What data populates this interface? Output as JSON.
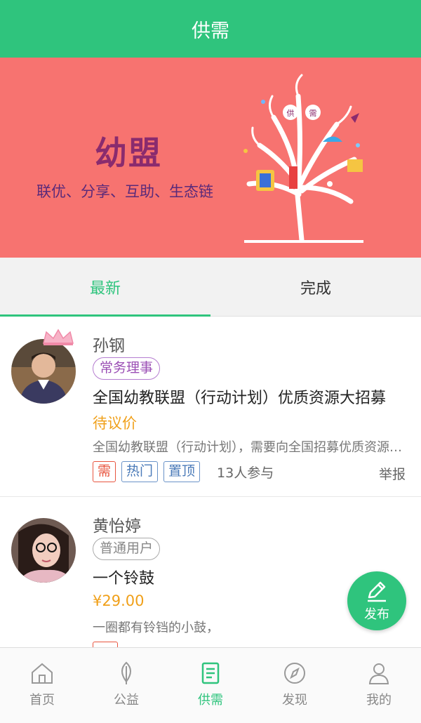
{
  "header": {
    "title": "供需"
  },
  "banner": {
    "title": "幼盟",
    "subtitle": "联优、分享、互助、生态链",
    "tree_labels": [
      "供",
      "需"
    ]
  },
  "tabs": [
    {
      "label": "最新",
      "active": true
    },
    {
      "label": "完成",
      "active": false
    }
  ],
  "items": [
    {
      "name": "孙钢",
      "role": "常务理事",
      "title": "全国幼教联盟（行动计划）优质资源大招募",
      "price": "待议价",
      "desc": "全国幼教联盟（行动计划），需要向全国招募优质资源…",
      "tags": [
        {
          "label": "需",
          "color": "red"
        },
        {
          "label": "热门",
          "color": "blue"
        },
        {
          "label": "置顶",
          "color": "blue"
        }
      ],
      "participants": "13人参与",
      "report": "举报"
    },
    {
      "name": "黄怡婷",
      "role": "普通用户",
      "title": "一个铃鼓",
      "price": "¥29.00",
      "desc": "一圈都有铃铛的小鼓，"
    }
  ],
  "fab": {
    "label": "发布",
    "icon": "pencil-icon"
  },
  "nav": [
    {
      "label": "首页",
      "icon": "home-icon",
      "active": false
    },
    {
      "label": "公益",
      "icon": "leaf-icon",
      "active": false
    },
    {
      "label": "供需",
      "icon": "document-icon",
      "active": true
    },
    {
      "label": "发现",
      "icon": "compass-icon",
      "active": false
    },
    {
      "label": "我的",
      "icon": "user-icon",
      "active": false
    }
  ],
  "colors": {
    "accent": "#2fc47d",
    "banner_bg": "#f77370",
    "price": "#f0a01a",
    "tag_red": "#e8553f",
    "tag_blue": "#4a7ab8"
  }
}
